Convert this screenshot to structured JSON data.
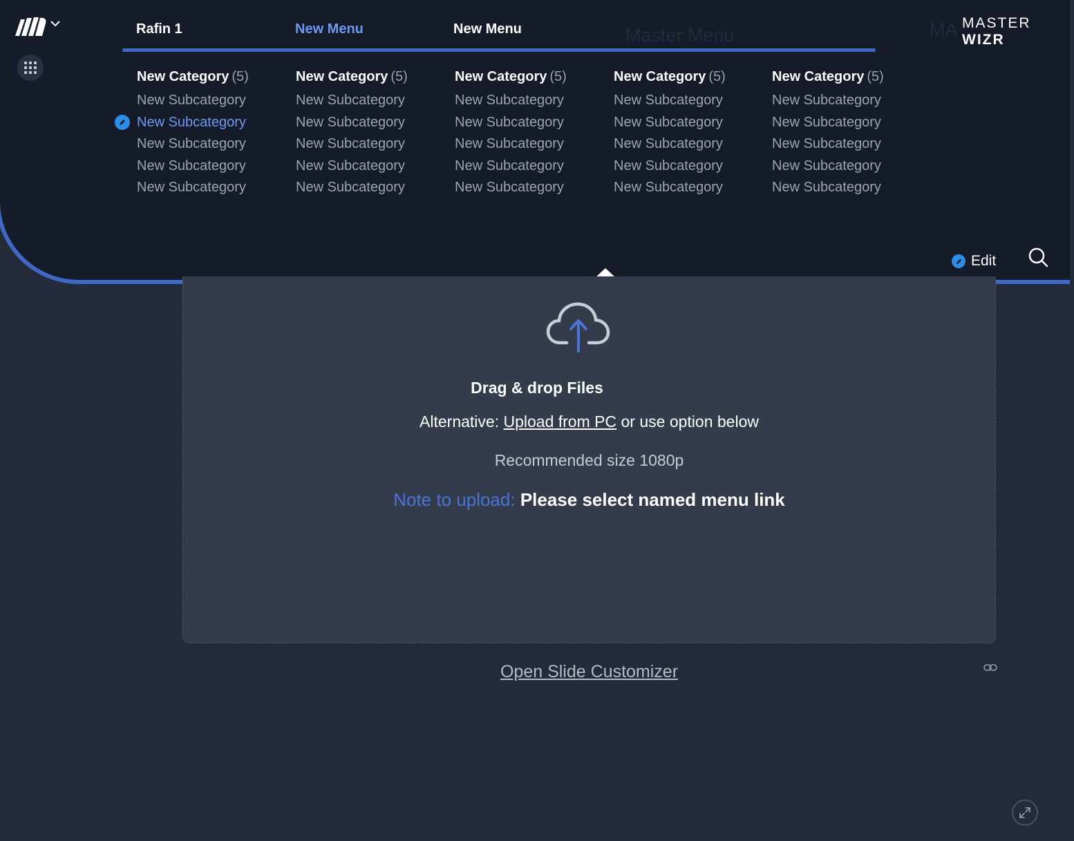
{
  "brand": {
    "prefix": "MASTER",
    "suffix": "WIZR"
  },
  "ghost_text": {
    "master_menu": "Master Menu",
    "ma": "MA"
  },
  "tabs": [
    {
      "label": "Rafin 1",
      "active": false
    },
    {
      "label": "New Menu",
      "active": true
    },
    {
      "label": "New Menu",
      "active": false
    }
  ],
  "columns": [
    {
      "category": "New Category",
      "count": "(5)",
      "subs": [
        "New Subcategory",
        "New Subcategory",
        "New Subcategory",
        "New Subcategory",
        "New Subcategory"
      ],
      "selected_index": 1
    },
    {
      "category": "New Category",
      "count": "(5)",
      "subs": [
        "New Subcategory",
        "New Subcategory",
        "New Subcategory",
        "New Subcategory",
        "New Subcategory"
      ]
    },
    {
      "category": "New Category",
      "count": "(5)",
      "subs": [
        "New Subcategory",
        "New Subcategory",
        "New Subcategory",
        "New Subcategory",
        "New Subcategory"
      ]
    },
    {
      "category": "New Category",
      "count": "(5)",
      "subs": [
        "New Subcategory",
        "New Subcategory",
        "New Subcategory",
        "New Subcategory",
        "New Subcategory"
      ]
    },
    {
      "category": "New Category",
      "count": "(5)",
      "subs": [
        "New Subcategory",
        "New Subcategory",
        "New Subcategory",
        "New Subcategory",
        "New Subcategory"
      ]
    }
  ],
  "edit_label": "Edit",
  "upload": {
    "title": "Drag & drop Files",
    "alt_prefix": "Alternative:",
    "alt_link": "Upload from PC",
    "alt_suffix": "or use option below",
    "recommended": "Recommended size 1080p",
    "note_label": "Note to upload:",
    "note_text": "Please select named menu link"
  },
  "customizer_link": "Open Slide Customizer",
  "icons": {
    "logo": "masterwizr-logo-icon",
    "apps": "apps-grid-icon",
    "search": "search-icon",
    "upload": "cloud-upload-icon",
    "link": "link-icon",
    "expand": "expand-icon",
    "edit": "pencil-icon"
  },
  "colors": {
    "accent": "#3f68c4",
    "active_text": "#6e99f0",
    "edit_dot": "#2c8fe6",
    "panel_bg": "#161b29",
    "page_bg": "#232b3b"
  }
}
